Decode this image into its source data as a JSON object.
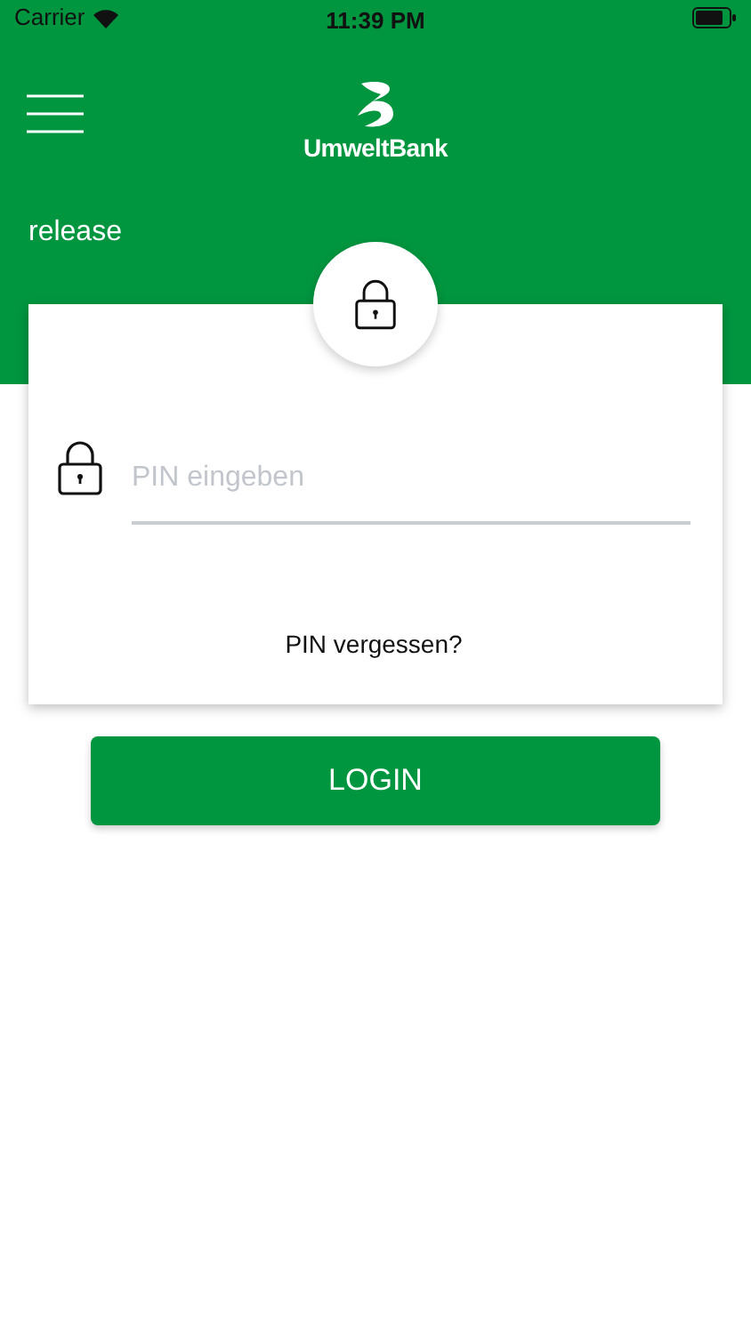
{
  "status_bar": {
    "carrier": "Carrier",
    "time": "11:39 PM"
  },
  "header": {
    "brand": "UmweltBank",
    "environment": "release"
  },
  "login_card": {
    "pin_field": {
      "placeholder": "PIN eingeben"
    },
    "forgot_link": "PIN vergessen?"
  },
  "login_button": "LOGIN"
}
